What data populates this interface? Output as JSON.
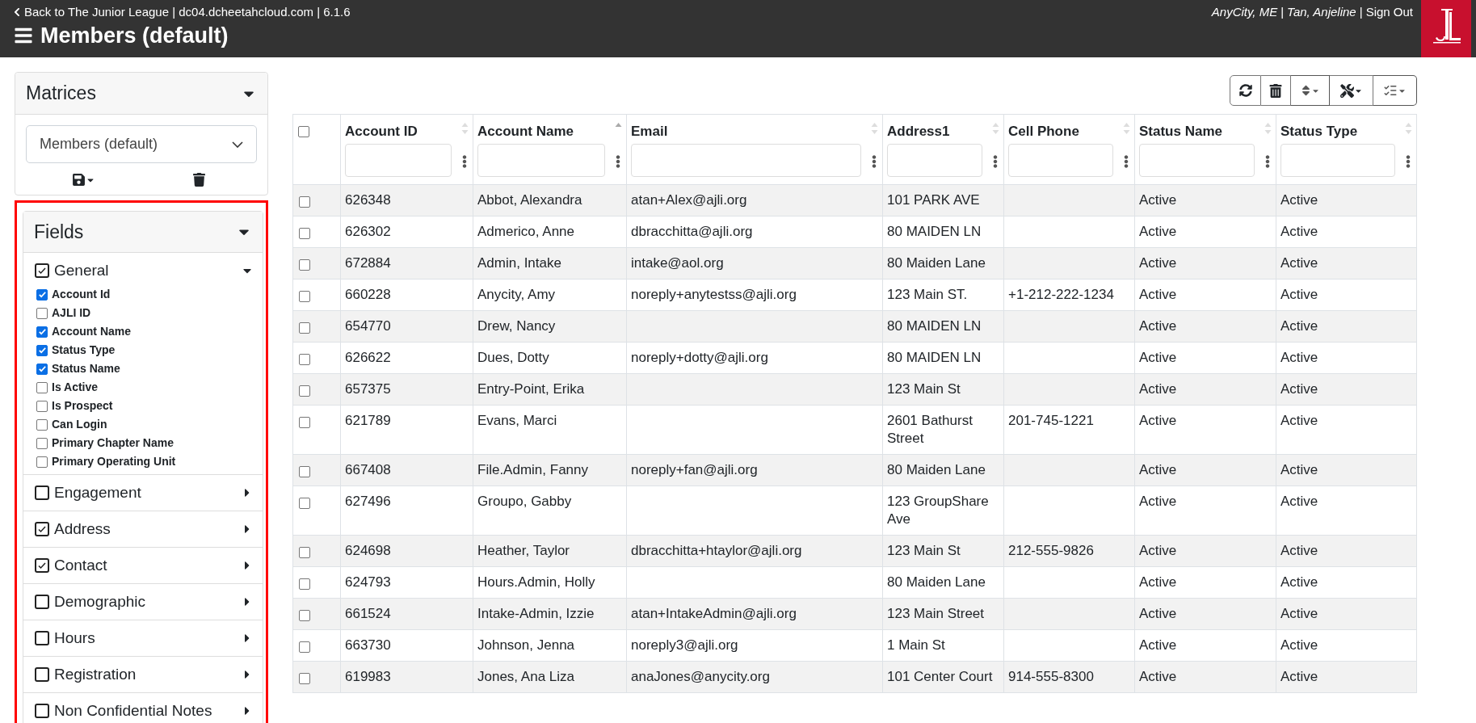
{
  "header": {
    "back_link": "Back to The Junior League | dc04.dcheetahcloud.com | 6.1.6",
    "title": "Members (default)",
    "location": "AnyCity, ME",
    "separator": "|",
    "user": "Tan, Anjeline",
    "sign_out": "Sign Out"
  },
  "matrices": {
    "title": "Matrices",
    "expanded": true,
    "selected_matrix": "Members (default)"
  },
  "fields": {
    "title": "Fields",
    "expanded": true,
    "groups": [
      {
        "label": "General",
        "checked": true,
        "expanded": true,
        "children": [
          {
            "label": "Account Id",
            "checked": true
          },
          {
            "label": "AJLI ID",
            "checked": false
          },
          {
            "label": "Account Name",
            "checked": true
          },
          {
            "label": "Status Type",
            "checked": true
          },
          {
            "label": "Status Name",
            "checked": true
          },
          {
            "label": "Is Active",
            "checked": false
          },
          {
            "label": "Is Prospect",
            "checked": false
          },
          {
            "label": "Can Login",
            "checked": false
          },
          {
            "label": "Primary Chapter Name",
            "checked": false
          },
          {
            "label": "Primary Operating Unit",
            "checked": false
          }
        ]
      },
      {
        "label": "Engagement",
        "checked": false,
        "expanded": false
      },
      {
        "label": "Address",
        "checked": true,
        "expanded": false
      },
      {
        "label": "Contact",
        "checked": true,
        "expanded": false
      },
      {
        "label": "Demographic",
        "checked": false,
        "expanded": false
      },
      {
        "label": "Hours",
        "checked": false,
        "expanded": false
      },
      {
        "label": "Registration",
        "checked": false,
        "expanded": false
      },
      {
        "label": "Non Confidential Notes",
        "checked": false,
        "expanded": false
      }
    ]
  },
  "table": {
    "all_checked": false,
    "columns": [
      {
        "label": "Account ID",
        "sorted": false
      },
      {
        "label": "Account Name",
        "sorted": true
      },
      {
        "label": "Email",
        "sorted": false
      },
      {
        "label": "Address1",
        "sorted": false
      },
      {
        "label": "Cell Phone",
        "sorted": false
      },
      {
        "label": "Status Name",
        "sorted": false
      },
      {
        "label": "Status Type",
        "sorted": false
      }
    ],
    "rows": [
      {
        "checked": false,
        "cells": [
          "626348",
          "Abbot, Alexandra",
          "atan+Alex@ajli.org",
          "101 PARK AVE",
          "",
          "Active",
          "Active"
        ]
      },
      {
        "checked": false,
        "cells": [
          "626302",
          "Admerico, Anne",
          "dbracchitta@ajli.org",
          "80 MAIDEN LN",
          "",
          "Active",
          "Active"
        ]
      },
      {
        "checked": false,
        "cells": [
          "672884",
          "Admin, Intake",
          "intake@aol.org",
          "80 Maiden Lane",
          "",
          "Active",
          "Active"
        ]
      },
      {
        "checked": false,
        "cells": [
          "660228",
          "Anycity, Amy",
          "noreply+anytestss@ajli.org",
          "123 Main ST.",
          "+1-212-222-1234",
          "Active",
          "Active"
        ]
      },
      {
        "checked": false,
        "cells": [
          "654770",
          "Drew, Nancy",
          "",
          "80 MAIDEN LN",
          "",
          "Active",
          "Active"
        ]
      },
      {
        "checked": false,
        "cells": [
          "626622",
          "Dues, Dotty",
          "noreply+dotty@ajli.org",
          "80 MAIDEN LN",
          "",
          "Active",
          "Active"
        ]
      },
      {
        "checked": false,
        "cells": [
          "657375",
          "Entry-Point, Erika",
          "",
          "123 Main St",
          "",
          "Active",
          "Active"
        ]
      },
      {
        "checked": false,
        "cells": [
          "621789",
          "Evans, Marci",
          "",
          "2601 Bathurst Street",
          "201-745-1221",
          "Active",
          "Active"
        ]
      },
      {
        "checked": false,
        "cells": [
          "667408",
          "File.Admin, Fanny",
          "noreply+fan@ajli.org",
          "80 Maiden Lane",
          "",
          "Active",
          "Active"
        ]
      },
      {
        "checked": false,
        "cells": [
          "627496",
          "Groupo, Gabby",
          "",
          "123 GroupShare Ave",
          "",
          "Active",
          "Active"
        ]
      },
      {
        "checked": false,
        "cells": [
          "624698",
          "Heather, Taylor",
          "dbracchitta+htaylor@ajli.org",
          "123 Main St",
          "212-555-9826",
          "Active",
          "Active"
        ]
      },
      {
        "checked": false,
        "cells": [
          "624793",
          "Hours.Admin, Holly",
          "",
          "80 Maiden Lane",
          "",
          "Active",
          "Active"
        ]
      },
      {
        "checked": false,
        "cells": [
          "661524",
          "Intake-Admin, Izzie",
          "atan+IntakeAdmin@ajli.org",
          "123 Main Street",
          "",
          "Active",
          "Active"
        ]
      },
      {
        "checked": false,
        "cells": [
          "663730",
          "Johnson, Jenna",
          "noreply3@ajli.org",
          "1 Main St",
          "",
          "Active",
          "Active"
        ]
      },
      {
        "checked": false,
        "cells": [
          "619983",
          "Jones, Ana Liza",
          "anaJones@anycity.org",
          "101 Center Court",
          "914-555-8300",
          "Active",
          "Active"
        ]
      }
    ]
  }
}
